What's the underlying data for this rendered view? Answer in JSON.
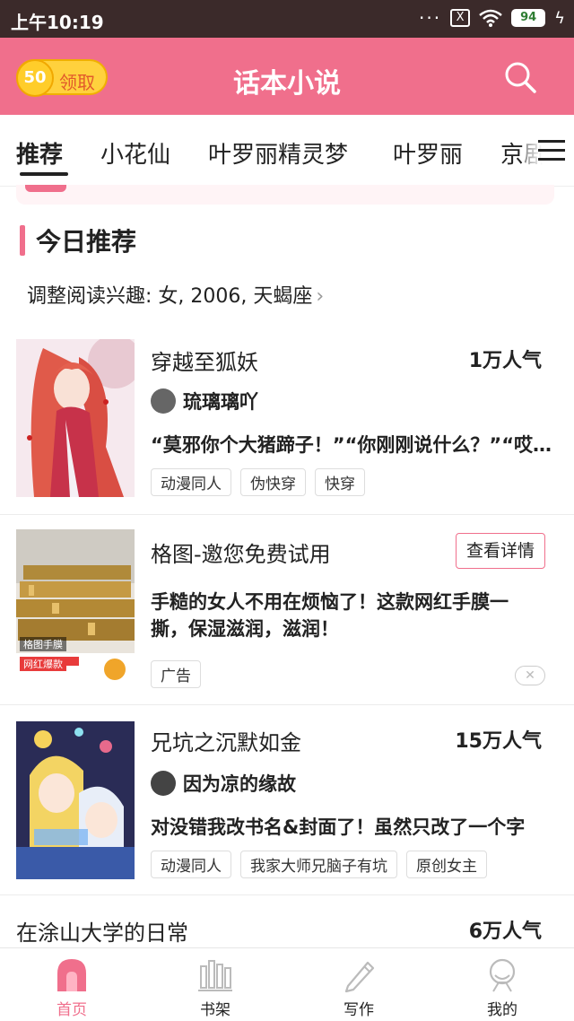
{
  "status": {
    "time": "上午10:19",
    "battery": "94",
    "sim": "X"
  },
  "header": {
    "coin_value": "50",
    "coin_label": "领取",
    "title": "话本小说"
  },
  "tabs": [
    {
      "label": "推荐"
    },
    {
      "label": "小花仙"
    },
    {
      "label": "叶罗丽精灵梦"
    },
    {
      "label": "叶罗丽"
    },
    {
      "label": "京剧"
    }
  ],
  "section": {
    "title": "今日推荐",
    "interest": "调整阅读兴趣: 女, 2006, 天蝎座"
  },
  "books": [
    {
      "title": "穿越至狐妖",
      "popularity": "1万人气",
      "author": "琉璃璃吖",
      "snippet": "“莫邪你个大猪蹄子！”“你刚刚说什么？”“哎呀我说你，说了什么了吗",
      "tags": [
        "动漫同人",
        "伪快穿",
        "快穿"
      ]
    },
    {
      "title": "兄坑之沉默如金",
      "popularity": "15万人气",
      "author": "因为凉的缘故",
      "snippet": "对没错我改书名&封面了！虽然只改了一个字",
      "tags": [
        "动漫同人",
        "我家大师兄脑子有坑",
        "原创女主"
      ]
    },
    {
      "title": "在涂山大学的日常",
      "popularity": "6万人气"
    }
  ],
  "ad": {
    "title": "格图-邀您免费试用",
    "button": "查看详情",
    "text": "手糙的女人不用在烦恼了！这款网红手膜一撕，保湿滋润，滋润！",
    "tag": "广告",
    "close": "✕",
    "image_caption": "格图手膜",
    "banner_text": "网红爆款"
  },
  "nav": [
    {
      "label": "首页",
      "icon": "home-icon"
    },
    {
      "label": "书架",
      "icon": "bookshelf-icon"
    },
    {
      "label": "写作",
      "icon": "pen-icon"
    },
    {
      "label": "我的",
      "icon": "profile-icon"
    }
  ],
  "colors": {
    "brand": "#f06f8c",
    "coin": "#ffd13d",
    "statusbar": "#3b2a2a"
  }
}
